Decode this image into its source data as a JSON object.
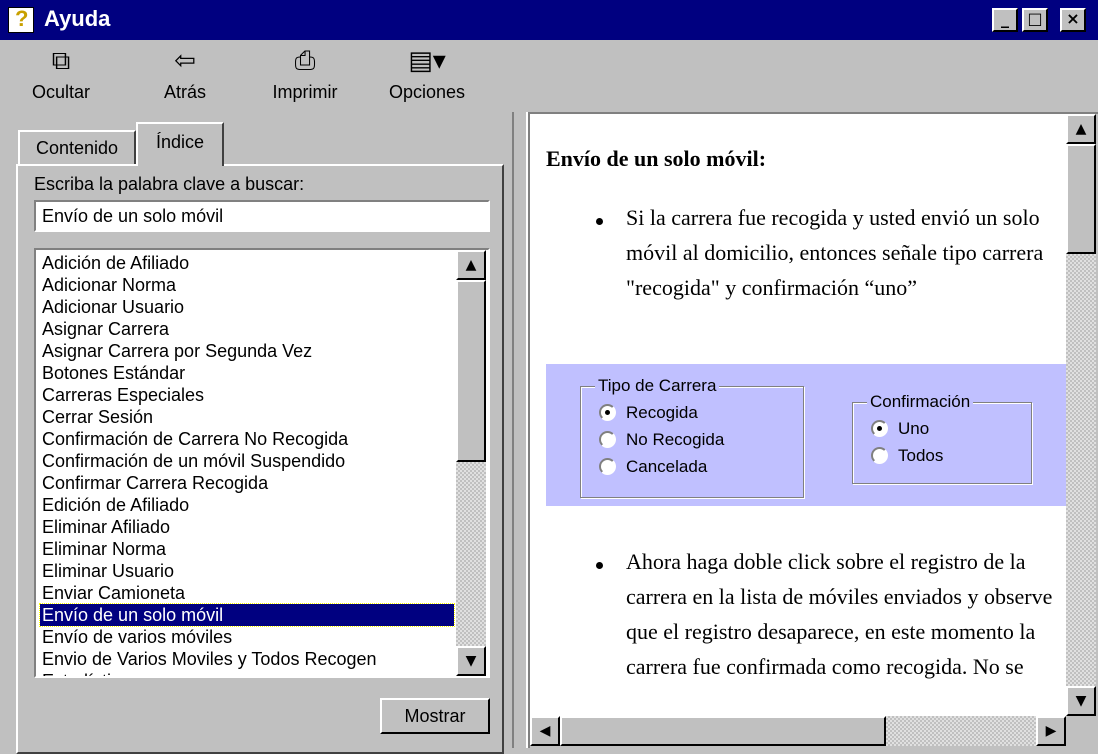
{
  "window": {
    "title": "Ayuda",
    "controls": [
      "_",
      "□",
      "×"
    ]
  },
  "toolbar": {
    "items": [
      {
        "label": "Ocultar",
        "icon": "hide-pane-icon",
        "glyph": "⧉"
      },
      {
        "label": "Atrás",
        "icon": "back-arrow-icon",
        "glyph": "⇦"
      },
      {
        "label": "Imprimir",
        "icon": "printer-icon",
        "glyph": "⎙"
      },
      {
        "label": "Opciones",
        "icon": "options-icon",
        "glyph": "▤▾"
      }
    ]
  },
  "tabs": {
    "contents": "Contenido",
    "index": "Índice"
  },
  "index_panel": {
    "prompt": "Escriba la palabra clave a buscar:",
    "search_value": "Envío de un solo móvil",
    "items": [
      "Adición de Afiliado",
      "Adicionar Norma",
      "Adicionar Usuario",
      "Asignar Carrera",
      "Asignar Carrera por Segunda Vez",
      "Botones Estándar",
      "Carreras Especiales",
      "Cerrar Sesión",
      "Confirmación de Carrera No Recogida",
      "Confirmación de un móvil Suspendido",
      "Confirmar Carrera Recogida",
      "Edición de Afiliado",
      "Eliminar Afiliado",
      "Eliminar Norma",
      "Eliminar Usuario",
      "Enviar Camioneta",
      "Envío de un solo móvil",
      "Envío de varios móviles",
      "Envio de Varios Moviles y Todos Recogen",
      "Estadísticas"
    ],
    "selected_item": "Envío de un solo móvil",
    "show_button": "Mostrar"
  },
  "topic": {
    "heading": "Envío de un solo móvil:",
    "bullet1": "Si la carrera fue recogida y usted envió un solo móvil al domicilio, entonces señale tipo carrera \"recogida\" y confirmación “uno”",
    "bullet2": "Ahora haga doble click sobre el registro de la carrera en la lista de móviles enviados y observe que el registro desaparece, en este momento la carrera fue confirmada como recogida. No se",
    "demo": {
      "type_group_title": "Tipo de Carrera",
      "type_options": [
        "Recogida",
        "No Recogida",
        "Cancelada"
      ],
      "type_selected": "Recogida",
      "confirm_group_title": "Confirmación",
      "confirm_options": [
        "Uno",
        "Todos"
      ],
      "confirm_selected": "Uno",
      "background": "#c0c0ff"
    }
  }
}
